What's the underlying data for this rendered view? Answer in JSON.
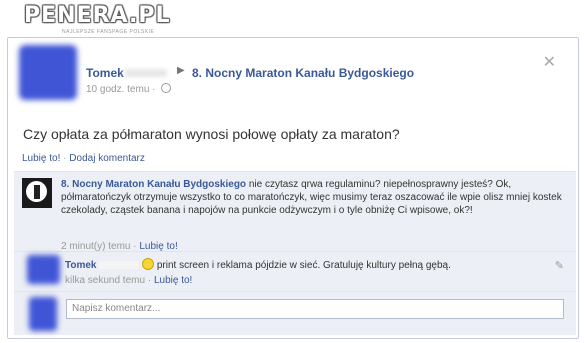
{
  "watermark": {
    "title": "PENERA.PL",
    "subtitle": "NAJLEPSZE FANSPAGE POLSKIE"
  },
  "post": {
    "author": "Tomek",
    "page": "8. Nocny Maraton Kanału Bydgoskiego",
    "time": "10 godz. temu",
    "text": "Czy opłata za półmaraton wynosi połowę opłaty za maraton?",
    "like_label": "Lubię to!",
    "comment_label": "Dodaj komentarz",
    "separator": "·"
  },
  "comments": [
    {
      "author": "8. Nocny Maraton Kanału Bydgoskiego",
      "text": "nie czytasz qrwa regulaminu? niepełnosprawny jesteś? Ok, półmaratończyk otrzymuje wszystko to co maratończyk, więc musimy teraz oszacować ile wpie   olisz mniej kostek czekolady, cząstek banana i napojów na punkcie odżywczym i o tyle obniżę Ci wpisowe, ok?!",
      "time": "2 minut(y) temu",
      "like_label": "Lubię to!"
    },
    {
      "author": "Tomek",
      "text": "print screen i reklama pójdzie w sieć. Gratuluję kultury pełną gębą.",
      "time": "kilka sekund temu",
      "like_label": "Lubię to!"
    }
  ],
  "compose": {
    "placeholder": "Napisz komentarz..."
  },
  "colors": {
    "link": "#3b5998",
    "comment_bg": "#eceff5",
    "border": "#c4cde0"
  }
}
